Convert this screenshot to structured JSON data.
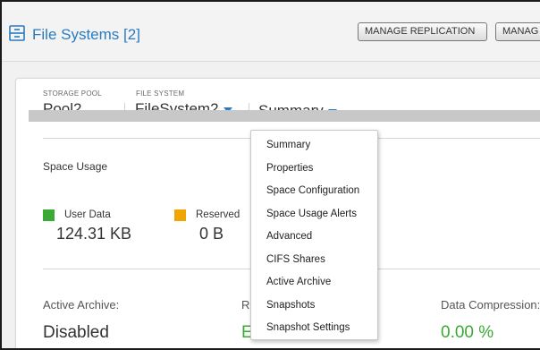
{
  "header": {
    "title": "File Systems [2]",
    "buttons": {
      "manage_replication": "MANAGE REPLICATION",
      "manage_other": "MANAG"
    }
  },
  "selectors": {
    "storage_pool": {
      "label": "STORAGE POOL",
      "value": "Pool2"
    },
    "file_system": {
      "label": "FILE SYSTEM",
      "value": "FileSystem2"
    },
    "view": {
      "value": "Summary"
    }
  },
  "space_usage": {
    "title": "Space Usage",
    "legend": [
      {
        "label": "User Data",
        "value": "124.31 KB",
        "color": "#3aaa35"
      },
      {
        "label": "Reserved",
        "value": "0 B",
        "color": "#f0a500"
      }
    ]
  },
  "stats": {
    "active_archive": {
      "label": "Active Archive:",
      "value": "Disabled"
    },
    "partial_label": "R",
    "partial_value": "E",
    "data_compression": {
      "label": "Data Compression:",
      "value": "0.00 %"
    }
  },
  "dropdown": {
    "items": [
      "Summary",
      "Properties",
      "Space Configuration",
      "Space Usage Alerts",
      "Advanced",
      "CIFS Shares",
      "Active Archive",
      "Snapshots",
      "Snapshot Settings"
    ]
  },
  "colors": {
    "accent": "#2a7bbf",
    "success": "#3aaa35",
    "warning": "#f0a500"
  }
}
